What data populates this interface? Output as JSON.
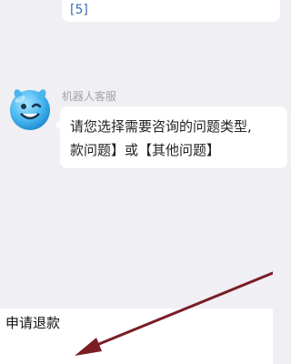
{
  "previous_message": {
    "link_text": "[5]"
  },
  "bot": {
    "name": "机器人客服",
    "avatar_icon": "smiley-bot-icon",
    "message_line1": "请您选择需要咨询的问题类型,",
    "message_line2": "款问题】或【其他问题】"
  },
  "quick_reply": {
    "label": "申请退款"
  },
  "annotation": {
    "arrow_color": "#7a1d25"
  }
}
